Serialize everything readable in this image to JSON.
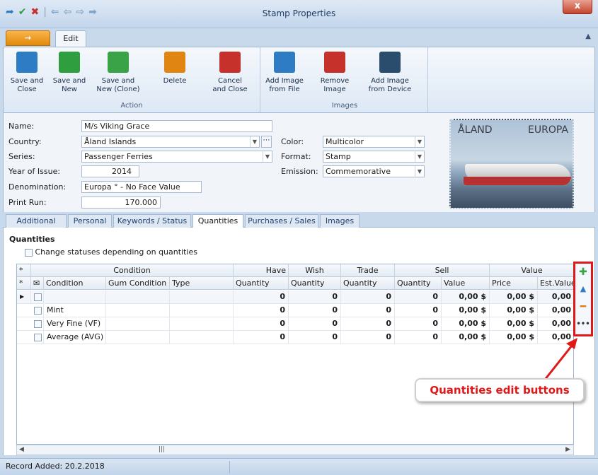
{
  "window": {
    "title": "Stamp Properties",
    "close_label": "x"
  },
  "qat": {
    "icons": [
      "back-arrow-icon",
      "check-icon",
      "x-icon",
      "history-back-icon",
      "arrow-left-icon",
      "arrow-right-icon",
      "arrow-next-icon"
    ]
  },
  "ribbon": {
    "app_tab": "→",
    "edit_tab": "Edit",
    "groups": [
      {
        "label": "Action",
        "buttons": [
          {
            "label": "Save and\nClose",
            "color": "#2d7cc4"
          },
          {
            "label": "Save and\nNew",
            "color": "#2f9e3e"
          },
          {
            "label": "Save and\nNew (Clone)",
            "color": "#3aa348"
          },
          {
            "label": "Delete",
            "color": "#e08512"
          },
          {
            "label": "Cancel\nand Close",
            "color": "#c7312b"
          }
        ]
      },
      {
        "label": "Images",
        "buttons": [
          {
            "label": "Add Image\nfrom File",
            "color": "#2d7cc4"
          },
          {
            "label": "Remove\nImage",
            "color": "#c7312b"
          },
          {
            "label": "Add Image\nfrom Device",
            "color": "#2a4d6e"
          }
        ]
      }
    ]
  },
  "form": {
    "name_label": "Name:",
    "name_value": "M/s Viking Grace",
    "country_label": "Country:",
    "country_value": "Åland Islands",
    "series_label": "Series:",
    "series_value": "Passenger Ferries",
    "year_label": "Year of Issue:",
    "year_value": "2014",
    "denom_label": "Denomination:",
    "denom_value": "Europa ° - No Face Value",
    "print_label": "Print Run:",
    "print_value": "170.000",
    "color_label": "Color:",
    "color_value": "Multicolor",
    "format_label": "Format:",
    "format_value": "Stamp",
    "emission_label": "Emission:",
    "emission_value": "Commemorative",
    "ellipsis": "⋯"
  },
  "stamp": {
    "left_text": "ÅLAND",
    "right_text": "EUROPA"
  },
  "tabs": [
    "Additional",
    "Personal",
    "Keywords / Status",
    "Quantities",
    "Purchases / Sales",
    "Images"
  ],
  "quantities": {
    "title": "Quantities",
    "change_status_label": "Change statuses depending on quantities",
    "group_headers": [
      "Condition",
      "Have",
      "Wish",
      "Trade",
      "Sell",
      "Value"
    ],
    "columns": [
      "Condition",
      "Gum Condition",
      "Type",
      "Quantity",
      "Quantity",
      "Quantity",
      "Quantity",
      "Value",
      "Price",
      "Est.Value"
    ],
    "rows": [
      {
        "condition": "",
        "gum": "",
        "type": "",
        "have": "0",
        "wish": "0",
        "trade": "0",
        "sell_qty": "0",
        "sell_val": "0,00 $",
        "price": "0,00 $",
        "est": "0,00"
      },
      {
        "condition": "Mint",
        "gum": "",
        "type": "",
        "have": "0",
        "wish": "0",
        "trade": "0",
        "sell_qty": "0",
        "sell_val": "0,00 $",
        "price": "0,00 $",
        "est": "0,00"
      },
      {
        "condition": "Very Fine (VF)",
        "gum": "",
        "type": "",
        "have": "0",
        "wish": "0",
        "trade": "0",
        "sell_qty": "0",
        "sell_val": "0,00 $",
        "price": "0,00 $",
        "est": "0,00"
      },
      {
        "condition": "Average (AVG)",
        "gum": "",
        "type": "",
        "have": "0",
        "wish": "0",
        "trade": "0",
        "sell_qty": "0",
        "sell_val": "0,00 $",
        "price": "0,00 $",
        "est": "0,00"
      }
    ],
    "edit_buttons": [
      {
        "name": "add-icon",
        "glyph": "✚",
        "color": "#3aa348"
      },
      {
        "name": "edit-icon",
        "glyph": "▲",
        "color": "#2d7cc4"
      },
      {
        "name": "remove-icon",
        "glyph": "━",
        "color": "#e07a12"
      },
      {
        "name": "more-icon",
        "glyph": "•••",
        "color": "#333333"
      }
    ]
  },
  "callout": {
    "text": "Quantities edit buttons",
    "color": "#e01818"
  },
  "status": {
    "text": "Record Added: 20.2.2018"
  },
  "scroll": {
    "left": "◀",
    "right": "▶",
    "grip": "|||"
  }
}
